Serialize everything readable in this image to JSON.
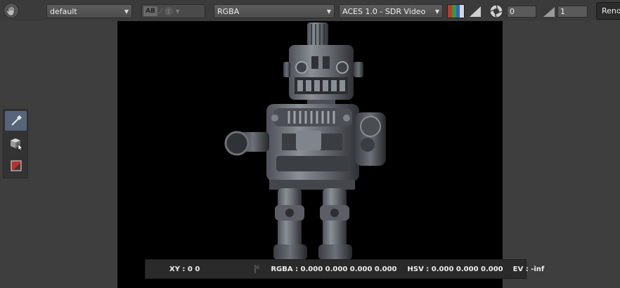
{
  "toolbar": {
    "preset_select": "default",
    "ab_label": "AB",
    "channel_index": "1",
    "channels_select": "RGBA",
    "transform_select": "ACES 1.0 - SDR Video",
    "exposure_value": "0",
    "gamma_value": "1",
    "render_label": "Render"
  },
  "status": {
    "xy": "XY : 0 0",
    "rgba": "RGBA : 0.000 0.000 0.000 0.000",
    "hsv": "HSV : 0.000 0.000 0.000",
    "ev": "EV : -inf"
  },
  "colors": {
    "accent_active": "#56657a",
    "channel_red": "#c0392b",
    "channel_green": "#2e9e3a",
    "channel_blue": "#3a5fc8"
  },
  "icons": [
    "hand-icon",
    "ab-compare-icon",
    "gradient-icon",
    "aperture-icon",
    "gamma-icon",
    "eyedropper-icon",
    "cube-select-icon",
    "region-icon",
    "cursor-icon",
    "plus-icon"
  ]
}
